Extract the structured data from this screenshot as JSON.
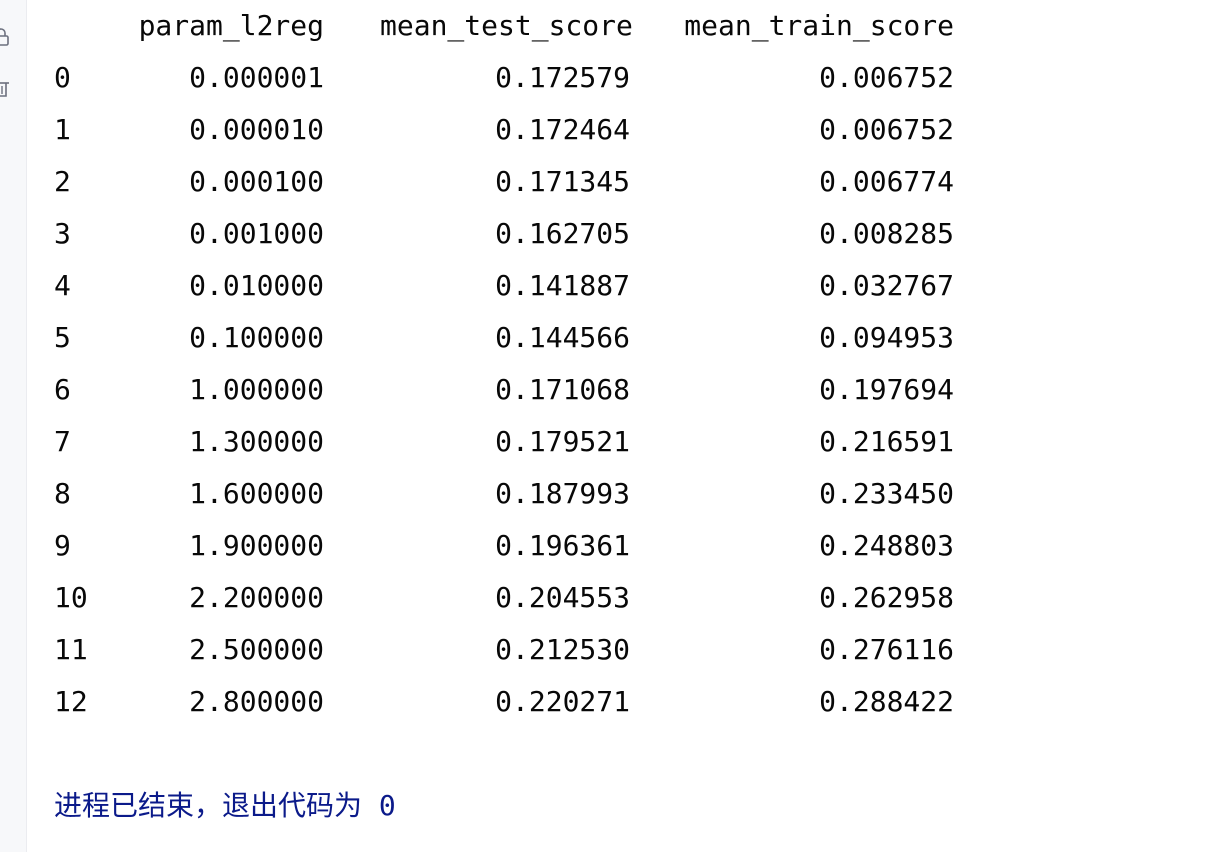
{
  "dataframe": {
    "columns": [
      "param_l2reg",
      "mean_test_score",
      "mean_train_score"
    ],
    "rows": [
      {
        "index": "0",
        "param_l2reg": "0.000001",
        "mean_test_score": "0.172579",
        "mean_train_score": "0.006752"
      },
      {
        "index": "1",
        "param_l2reg": "0.000010",
        "mean_test_score": "0.172464",
        "mean_train_score": "0.006752"
      },
      {
        "index": "2",
        "param_l2reg": "0.000100",
        "mean_test_score": "0.171345",
        "mean_train_score": "0.006774"
      },
      {
        "index": "3",
        "param_l2reg": "0.001000",
        "mean_test_score": "0.162705",
        "mean_train_score": "0.008285"
      },
      {
        "index": "4",
        "param_l2reg": "0.010000",
        "mean_test_score": "0.141887",
        "mean_train_score": "0.032767"
      },
      {
        "index": "5",
        "param_l2reg": "0.100000",
        "mean_test_score": "0.144566",
        "mean_train_score": "0.094953"
      },
      {
        "index": "6",
        "param_l2reg": "1.000000",
        "mean_test_score": "0.171068",
        "mean_train_score": "0.197694"
      },
      {
        "index": "7",
        "param_l2reg": "1.300000",
        "mean_test_score": "0.179521",
        "mean_train_score": "0.216591"
      },
      {
        "index": "8",
        "param_l2reg": "1.600000",
        "mean_test_score": "0.187993",
        "mean_train_score": "0.233450"
      },
      {
        "index": "9",
        "param_l2reg": "1.900000",
        "mean_test_score": "0.196361",
        "mean_train_score": "0.248803"
      },
      {
        "index": "10",
        "param_l2reg": "2.200000",
        "mean_test_score": "0.204553",
        "mean_train_score": "0.262958"
      },
      {
        "index": "11",
        "param_l2reg": "2.500000",
        "mean_test_score": "0.212530",
        "mean_train_score": "0.276116"
      },
      {
        "index": "12",
        "param_l2reg": "2.800000",
        "mean_test_score": "0.220271",
        "mean_train_score": "0.288422"
      }
    ]
  },
  "exit_message": "进程已结束，退出代码为 0",
  "gutter_icons": [
    "lock-icon",
    "trash-icon"
  ],
  "colors": {
    "background": "#ffffff",
    "gutter": "#f7f8fa",
    "text": "#080808",
    "exit_text": "#0b1a8a"
  }
}
